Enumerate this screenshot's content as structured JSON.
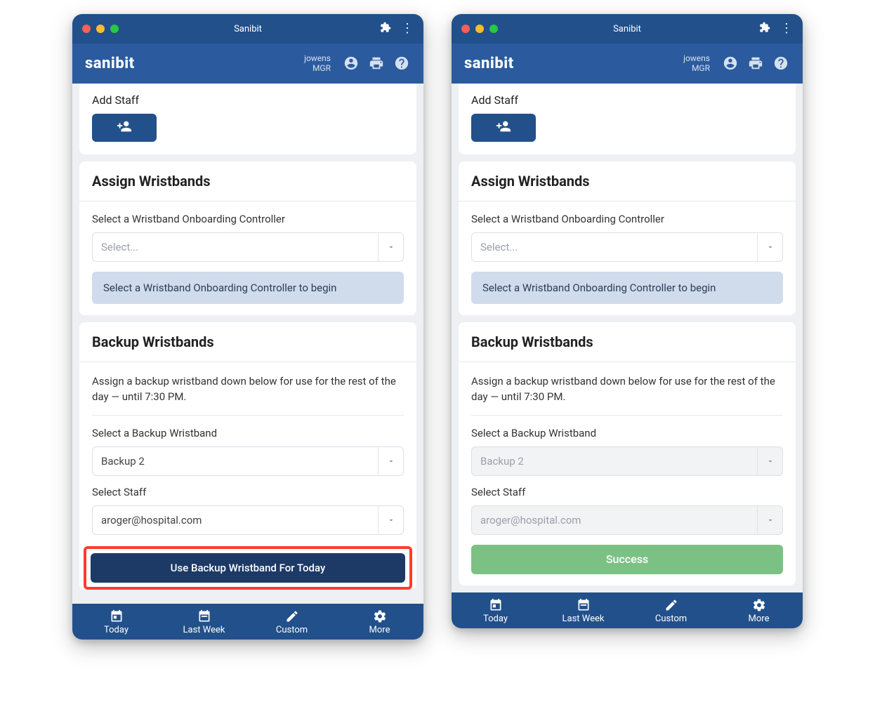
{
  "window": {
    "title": "Sanibit"
  },
  "appbar": {
    "brand": "sanibit",
    "user": "jowens",
    "role": "MGR"
  },
  "addStaff": {
    "label": "Add Staff"
  },
  "assign": {
    "title": "Assign Wristbands",
    "controllerLabel": "Select a Wristband Onboarding Controller",
    "controllerPlaceholder": "Select...",
    "banner": "Select a Wristband Onboarding Controller to begin"
  },
  "backup": {
    "title": "Backup Wristbands",
    "desc": "Assign a backup wristband down below for use for the rest of the day — until 7:30 PM.",
    "selectBackupLabel": "Select a Backup Wristband",
    "selectBackupValue": "Backup 2",
    "selectStaffLabel": "Select Staff",
    "selectStaffValue": "aroger@hospital.com",
    "ctaLabel": "Use Backup Wristband For Today",
    "successLabel": "Success"
  },
  "tabs": {
    "today": "Today",
    "lastWeek": "Last Week",
    "custom": "Custom",
    "more": "More"
  }
}
